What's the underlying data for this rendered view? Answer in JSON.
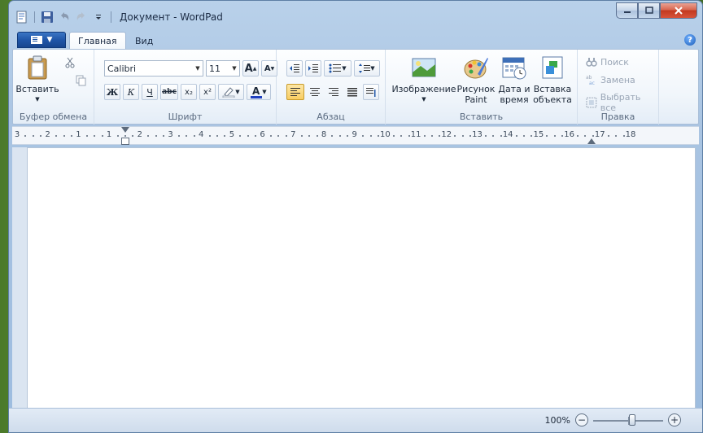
{
  "window": {
    "title": "Документ - WordPad"
  },
  "tabs": [
    {
      "label": "Главная",
      "active": true
    },
    {
      "label": "Вид",
      "active": false
    }
  ],
  "ribbon": {
    "clipboard": {
      "group_label": "Буфер обмена",
      "paste_label": "Вставить"
    },
    "font": {
      "group_label": "Шрифт",
      "font_name": "Calibri",
      "font_size": "11",
      "bold": "Ж",
      "italic": "К",
      "underline": "Ч",
      "strike": "abc",
      "subscript": "x₂",
      "superscript": "x²",
      "grow": "A",
      "shrink": "A"
    },
    "paragraph": {
      "group_label": "Абзац"
    },
    "insert": {
      "group_label": "Вставить",
      "image_label": "Изображение",
      "paint_label_1": "Рисунок",
      "paint_label_2": "Paint",
      "datetime_label_1": "Дата и",
      "datetime_label_2": "время",
      "object_label_1": "Вставка",
      "object_label_2": "объекта"
    },
    "editing": {
      "group_label": "Правка",
      "find_label": "Поиск",
      "replace_label": "Замена",
      "select_all_label": "Выбрать все"
    }
  },
  "ruler": {
    "marks": [
      {
        "label": "3"
      },
      {
        "label": "2"
      },
      {
        "label": "1"
      },
      {
        "label": "1"
      },
      {
        "label": "2"
      },
      {
        "label": "3"
      },
      {
        "label": "4"
      },
      {
        "label": "5"
      },
      {
        "label": "6"
      },
      {
        "label": "7"
      },
      {
        "label": "8"
      },
      {
        "label": "9"
      },
      {
        "label": "10"
      },
      {
        "label": "11"
      },
      {
        "label": "12"
      },
      {
        "label": "13"
      },
      {
        "label": "14"
      },
      {
        "label": "15"
      },
      {
        "label": "16"
      },
      {
        "label": "17"
      },
      {
        "label": "18"
      }
    ]
  },
  "status": {
    "zoom": "100%",
    "zoom_minus": "−",
    "zoom_plus": "+"
  },
  "colors": {
    "accent": "#1f56a8",
    "close": "#c2391f",
    "highlight": "#f8cd62"
  }
}
